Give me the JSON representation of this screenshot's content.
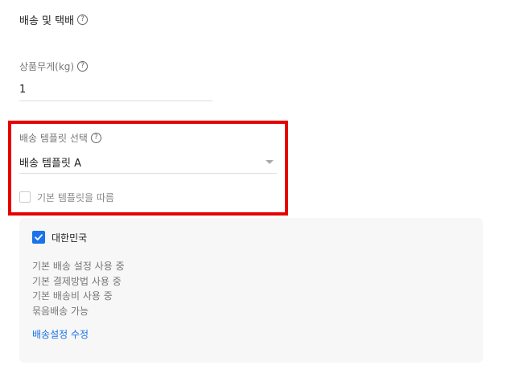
{
  "section": {
    "title": "배송 및 택배",
    "help_glyph": "?"
  },
  "weight": {
    "label": "상품무게(kg)",
    "value": "1",
    "help_glyph": "?"
  },
  "template": {
    "label": "배송 템플릿 선택",
    "help_glyph": "?",
    "selected": "배송 템플릿 A",
    "default_checkbox_label": "기본 템플릿을 따름",
    "default_checked": false
  },
  "country": {
    "name": "대한민국",
    "checked": true,
    "info_lines": [
      "기본 배송 설정 사용 중",
      "기본 결제방법 사용 중",
      "기본 배송비 사용 중",
      "묶음배송 가능"
    ],
    "edit_link": "배송설정 수정"
  },
  "colors": {
    "accent": "#1a73e8",
    "highlight": "#e60000"
  },
  "icons": {
    "help": "question-circle-icon",
    "caret": "chevron-down-icon",
    "check": "check-icon"
  }
}
